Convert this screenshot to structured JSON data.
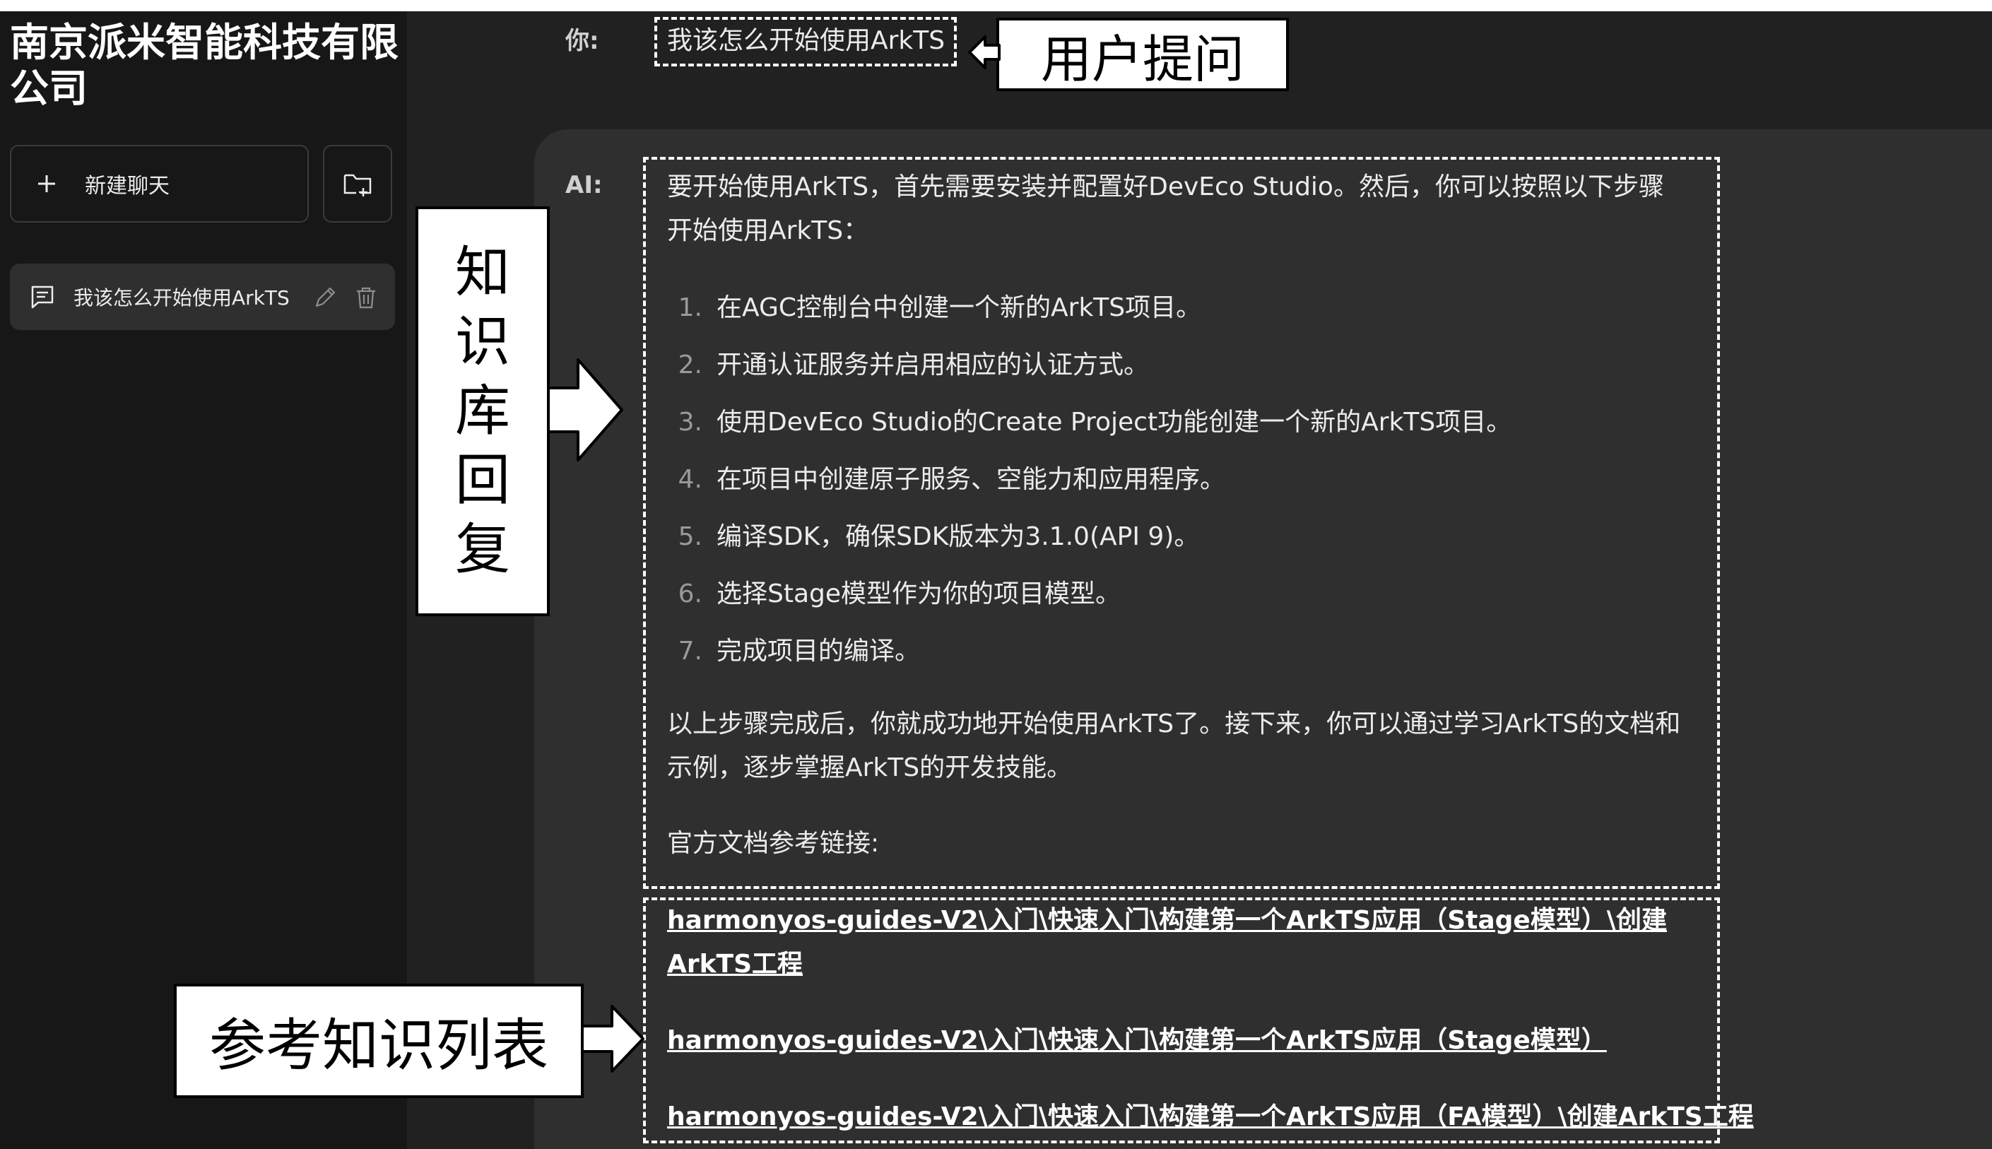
{
  "sidebar": {
    "company_name": "南京派米智能科技有限公司",
    "new_chat_label": "新建聊天",
    "history": [
      {
        "label": "我该怎么开始使用ArkTS"
      }
    ]
  },
  "conversation": {
    "you_label": "你:",
    "ai_label": "AI:",
    "user_question": "我该怎么开始使用ArkTS",
    "response": {
      "intro": "要开始使用ArkTS，首先需要安装并配置好DevEco Studio。然后，你可以按照以下步骤开始使用ArkTS：",
      "steps": [
        {
          "num": "1.",
          "text": "在AGC控制台中创建一个新的ArkTS项目。"
        },
        {
          "num": "2.",
          "text": "开通认证服务并启用相应的认证方式。"
        },
        {
          "num": "3.",
          "text": "使用DevEco Studio的Create Project功能创建一个新的ArkTS项目。"
        },
        {
          "num": "4.",
          "text": "在项目中创建原子服务、空能力和应用程序。"
        },
        {
          "num": "5.",
          "text": "编译SDK，确保SDK版本为3.1.0(API 9)。"
        },
        {
          "num": "6.",
          "text": "选择Stage模型作为你的项目模型。"
        },
        {
          "num": "7.",
          "text": "完成项目的编译。"
        }
      ],
      "outro": "以上步骤完成后，你就成功地开始使用ArkTS了。接下来，你可以通过学习ArkTS的文档和示例，逐步掌握ArkTS的开发技能。",
      "docs_heading": "官方文档参考链接:",
      "links": [
        "harmonyos-guides-V2\\入门\\快速入门\\构建第一个ArkTS应用（Stage模型）\\创建ArkTS工程",
        "harmonyos-guides-V2\\入门\\快速入门\\构建第一个ArkTS应用（Stage模型）",
        "harmonyos-guides-V2\\入门\\快速入门\\构建第一个ArkTS应用（FA模型）\\创建ArkTS工程"
      ]
    }
  },
  "annotations": {
    "user_question_callout": "用户提问",
    "kb_reply_callout": [
      "知",
      "识",
      "库",
      "回",
      "复"
    ],
    "ref_list_callout": "参考知识列表"
  },
  "colors": {
    "sidebar_bg": "#171717",
    "main_bg": "#212121",
    "ai_panel_bg": "#2f2f2f",
    "text": "#ececec",
    "annotation_fill": "#ffffff",
    "annotation_border": "#000000"
  }
}
